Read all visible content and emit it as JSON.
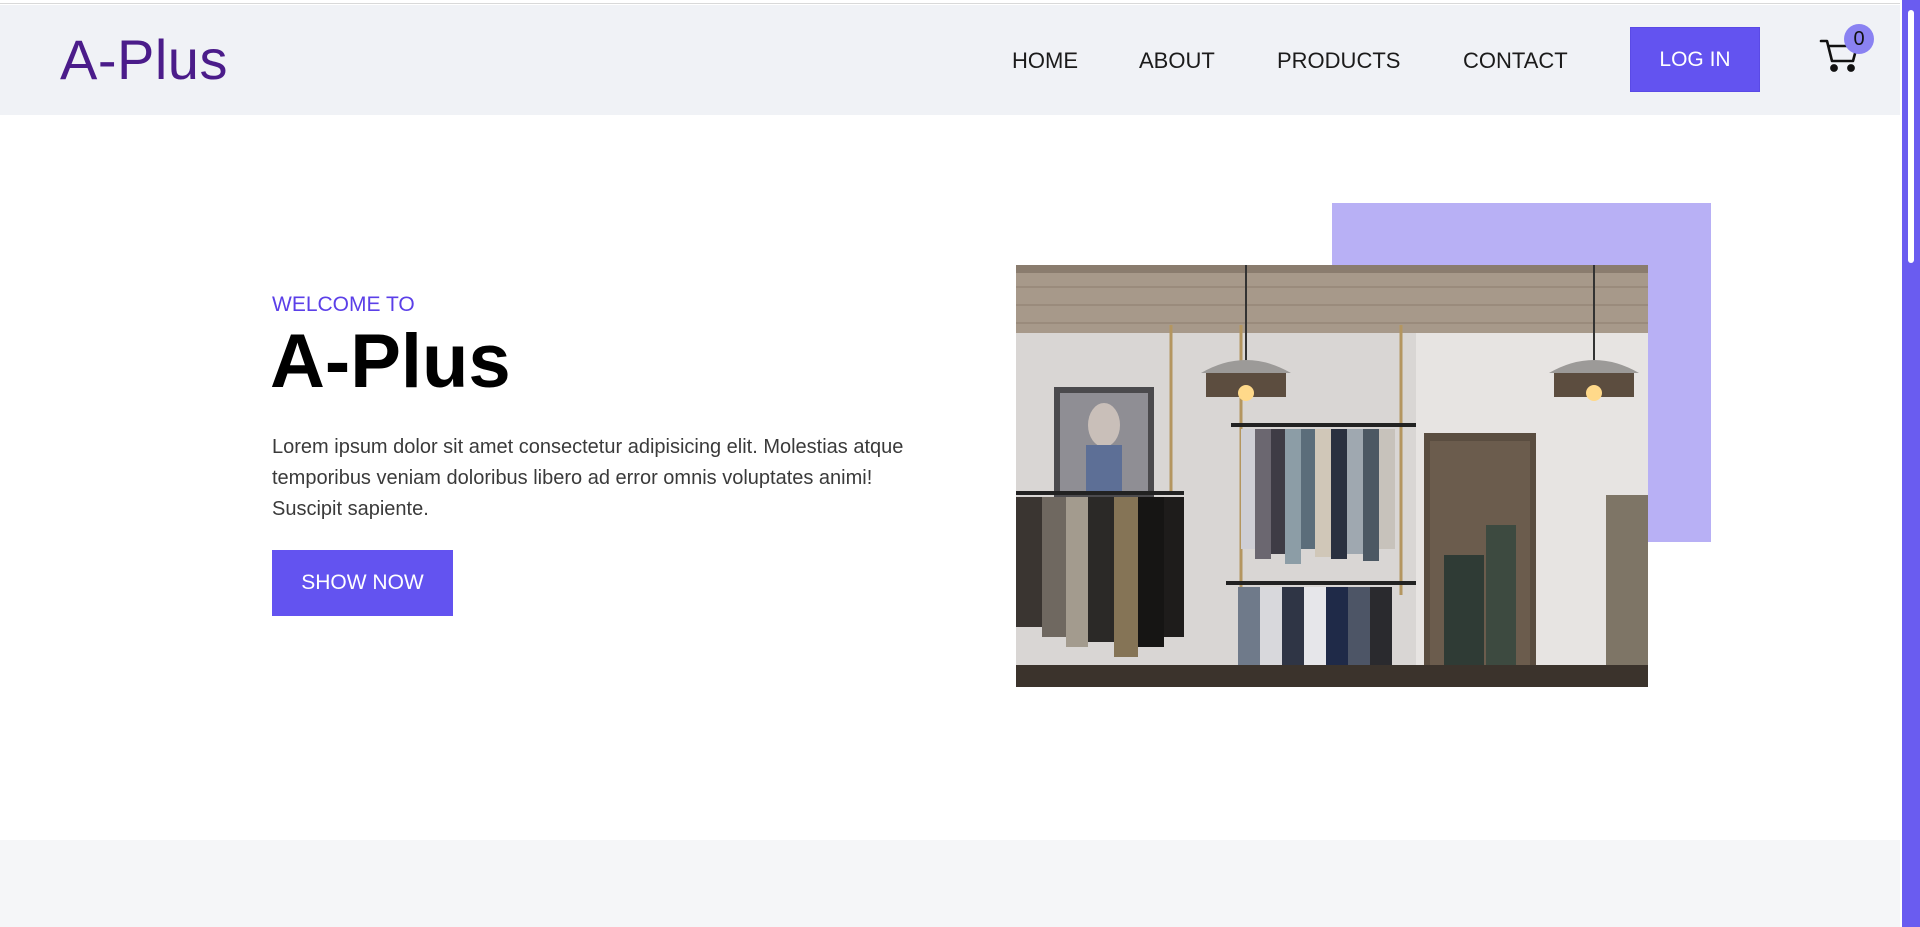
{
  "brand": {
    "logo_text": "A-Plus",
    "accent_color": "#6353f0",
    "logo_color": "#4b1c8a"
  },
  "nav": {
    "links": [
      {
        "label": "HOME"
      },
      {
        "label": "ABOUT"
      },
      {
        "label": "PRODUCTS"
      },
      {
        "label": "CONTACT"
      }
    ],
    "login_label": "LOG IN",
    "cart_icon": "cart-icon",
    "cart_count": "0"
  },
  "hero": {
    "welcome": "WELCOME TO",
    "title": "A-Plus",
    "description": "Lorem ipsum dolor sit amet consectetur adipisicing elit. Molestias atque temporibus veniam doloribus libero ad error omnis voluptates animi! Suscipit sapiente.",
    "button_label": "SHOW NOW",
    "image": "clothing-store-photo"
  }
}
